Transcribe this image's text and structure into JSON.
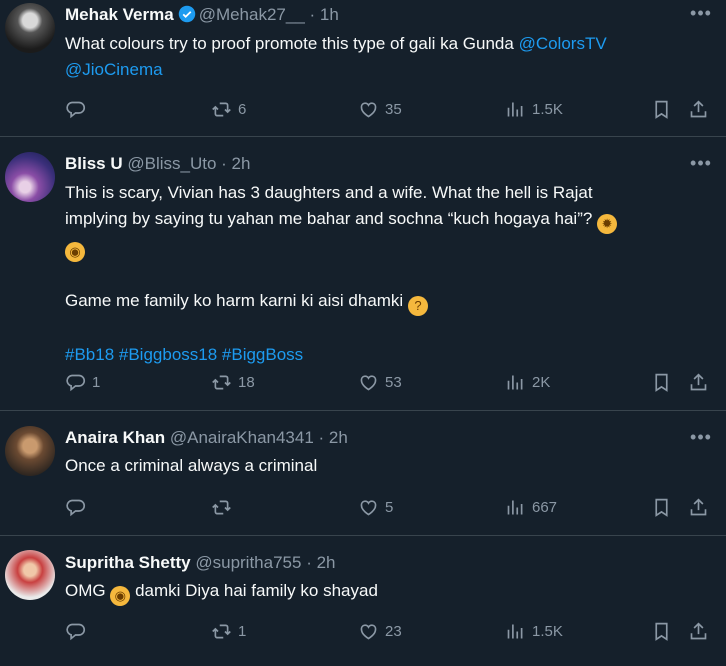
{
  "tweets": [
    {
      "name": "Mehak Verma",
      "handle": "@Mehak27__",
      "time": "· 1h",
      "verified": true,
      "text_parts": [
        "What colours   try to proof promote this type of gali ka Gunda "
      ],
      "mention1": "@ColorsTV",
      "mention2": "@JioCinema",
      "replies": "",
      "retweets": "6",
      "likes": "35",
      "views": "1.5K"
    },
    {
      "name": "Bliss U",
      "handle": "@Bliss_Uto",
      "time": "· 2h",
      "line1": "This is scary, Vivian has 3 daughters and a wife. What the hell is Rajat",
      "line2": "implying by saying tu yahan me bahar and sochna “kuch hogaya hai”?",
      "line3": "Game me family ko harm karni ki aisi dhamki",
      "hashtags": "#Bb18 #Biggboss18 #BiggBoss",
      "replies": "1",
      "retweets": "18",
      "likes": "53",
      "views": "2K"
    },
    {
      "name": "Anaira Khan",
      "handle": "@AnairaKhan4341",
      "time": "· 2h",
      "text": "Once a criminal always a criminal",
      "replies": "",
      "retweets": "",
      "likes": "5",
      "views": "667"
    },
    {
      "name": "Supritha Shetty",
      "handle": "@supritha755",
      "time": "· 2h",
      "text_a": "OMG",
      "text_b": "damki Diya hai family ko shayad",
      "replies": "",
      "retweets": "1",
      "likes": "23",
      "views": "1.5K"
    }
  ],
  "icons": {
    "reply": "reply-icon",
    "retweet": "retweet-icon",
    "like": "heart-icon",
    "views": "views-icon",
    "bookmark": "bookmark-icon",
    "share": "share-icon",
    "more": "more-icon"
  },
  "colors": {
    "background": "#15202b",
    "link": "#1d9bf0",
    "muted": "#8b98a5",
    "verified": "#1d9bf0"
  }
}
